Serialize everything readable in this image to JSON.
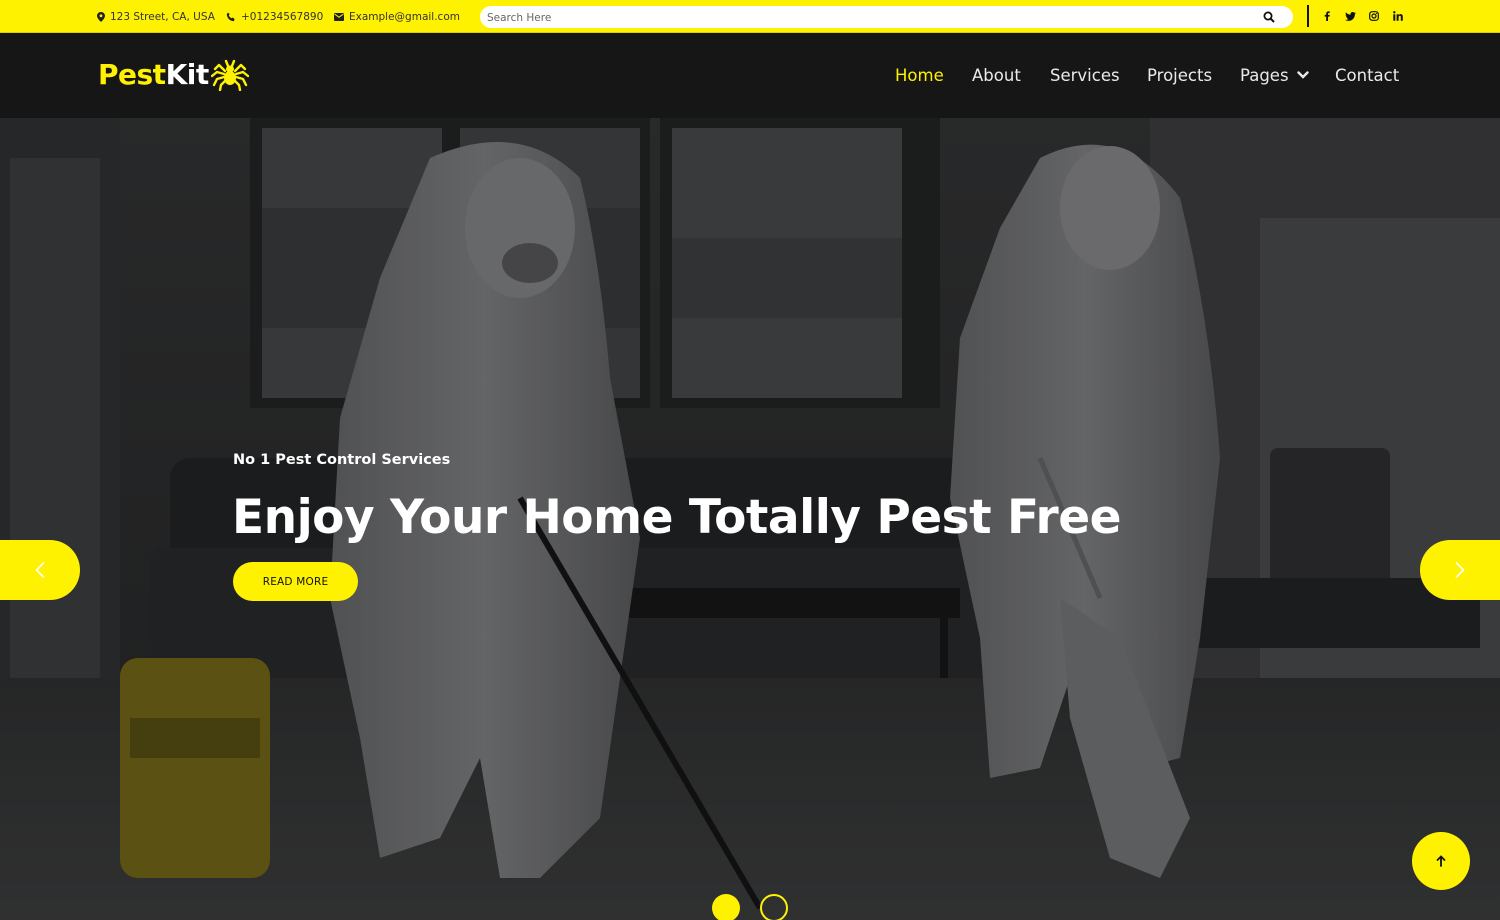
{
  "topbar": {
    "address": "123 Street, CA, USA",
    "phone": "+01234567890",
    "email": "Example@gmail.com",
    "search_placeholder": "Search Here",
    "socials": [
      "facebook-icon",
      "twitter-icon",
      "instagram-icon",
      "linkedin-icon"
    ]
  },
  "brand": {
    "part1": "Pest",
    "part2": "Kit",
    "icon": "spider-icon"
  },
  "nav": {
    "items": [
      {
        "label": "Home",
        "active": true
      },
      {
        "label": "About",
        "active": false
      },
      {
        "label": "Services",
        "active": false
      },
      {
        "label": "Projects",
        "active": false
      },
      {
        "label": "Pages",
        "active": false,
        "dropdown": true
      },
      {
        "label": "Contact",
        "active": false
      }
    ]
  },
  "hero": {
    "eyebrow": "No 1 Pest Control Services",
    "headline": "Enjoy Your Home Totally Pest Free",
    "cta": "READ MORE",
    "slides_total": 2,
    "active_slide": 1
  },
  "colors": {
    "accent": "#FFF200",
    "nav_bg": "#161616",
    "text_dark": "#111111"
  }
}
